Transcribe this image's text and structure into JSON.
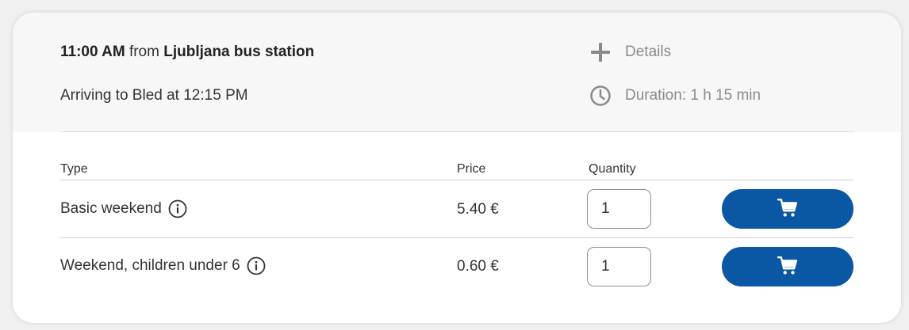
{
  "trip": {
    "time": "11:00 AM",
    "from_word": "from",
    "station": "Ljubljana bus station",
    "arrival": "Arriving to Bled at 12:15 PM",
    "details_label": "Details",
    "duration": "Duration: 1 h 15 min"
  },
  "table": {
    "headers": {
      "type": "Type",
      "price": "Price",
      "quantity": "Quantity"
    },
    "rows": [
      {
        "type": "Basic weekend",
        "price": "5.40 €",
        "quantity": "1"
      },
      {
        "type": "Weekend, children under 6",
        "price": "0.60 €",
        "quantity": "1"
      }
    ]
  },
  "icons": {
    "details": "plus-icon",
    "duration": "clock-icon",
    "info": "info-icon",
    "cart": "cart-icon"
  },
  "colors": {
    "accent": "#0a57a3",
    "muted_text": "#8a8a8a",
    "header_bg": "#f7f7f7"
  }
}
